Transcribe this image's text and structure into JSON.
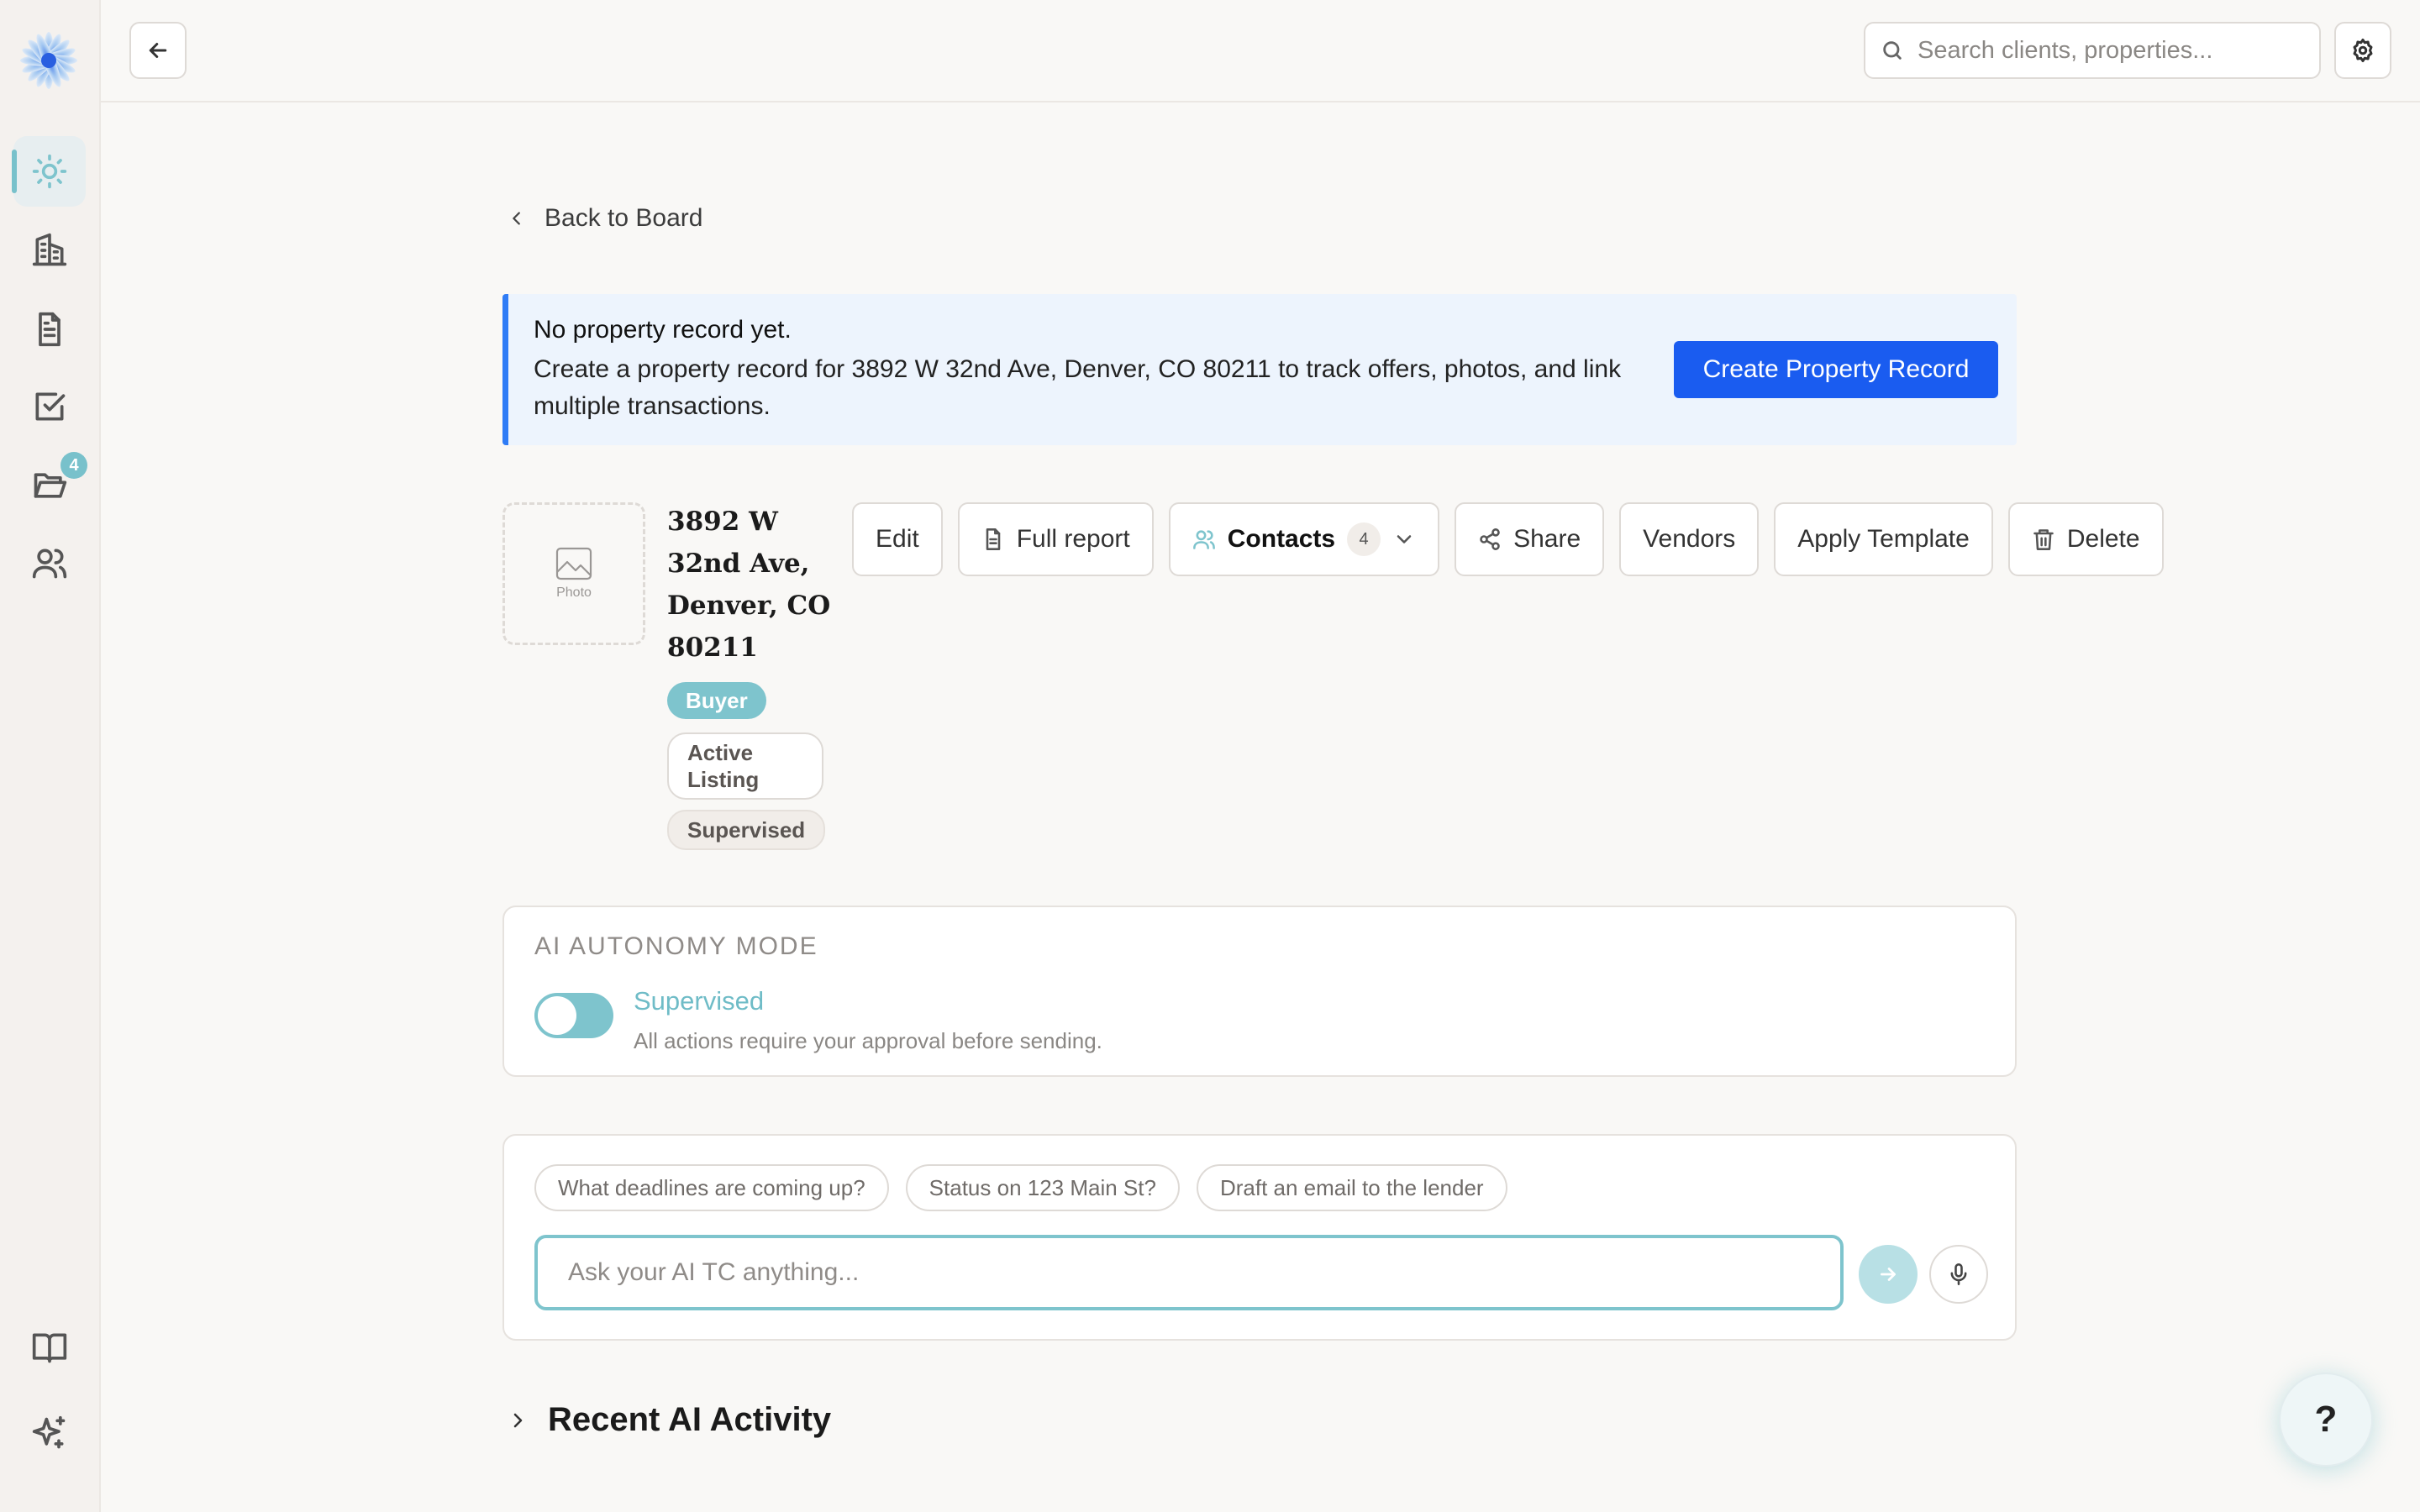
{
  "topbar": {
    "search_placeholder": "Search clients, properties..."
  },
  "sidebar": {
    "items": [
      {
        "icon": "sun-icon",
        "active": true
      },
      {
        "icon": "building-icon"
      },
      {
        "icon": "document-icon"
      },
      {
        "icon": "checkbox-icon"
      },
      {
        "icon": "folder-icon",
        "badge": "4"
      },
      {
        "icon": "users-icon"
      },
      {
        "icon": "book-icon"
      },
      {
        "icon": "sparkle-icon"
      }
    ]
  },
  "main": {
    "back_label": "Back to Board",
    "banner": {
      "title": "No property record yet.",
      "text_before": "Create a property record for ",
      "address": "3892 W 32nd Ave, Denver, CO 80211",
      "text_after": " to track offers, photos, and link multiple transactions.",
      "button": "Create Property Record"
    },
    "property": {
      "photo_label": "Photo",
      "title": "3892 W 32nd Ave, Denver, CO 80211",
      "tags": [
        "Buyer",
        "Active Listing",
        "Supervised"
      ]
    },
    "actions": {
      "edit": "Edit",
      "full_report": "Full report",
      "contacts": "Contacts",
      "contacts_count": "4",
      "share": "Share",
      "vendors": "Vendors",
      "apply_template": "Apply Template",
      "delete": "Delete"
    },
    "autonomy": {
      "heading": "AI AUTONOMY MODE",
      "mode": "Supervised",
      "description": "All actions require your approval before sending."
    },
    "chat": {
      "chips": [
        "What deadlines are coming up?",
        "Status on 123 Main St?",
        "Draft an email to the lender"
      ],
      "placeholder": "Ask your AI TC anything..."
    },
    "recent_heading": "Recent AI Activity",
    "help_label": "?"
  },
  "colors": {
    "accent": "#7ec4cd",
    "primary_button": "#1a5cf0",
    "banner_bg": "#edf4fd",
    "banner_border": "#2f7cf6"
  }
}
